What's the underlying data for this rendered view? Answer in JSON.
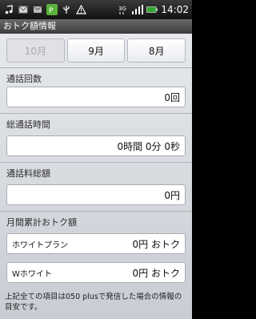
{
  "status_bar": {
    "icons_left": [
      "music-icon",
      "message-icon",
      "mail-icon",
      "app-icon",
      "usb-icon",
      "warning-icon"
    ],
    "network": "3G",
    "time": "14:02"
  },
  "title": "おトク額情報",
  "tabs": [
    {
      "label": "10月",
      "state": "disabled"
    },
    {
      "label": "9月",
      "state": "normal"
    },
    {
      "label": "8月",
      "state": "normal"
    }
  ],
  "call_count": {
    "label": "通話回数",
    "value": "0回"
  },
  "call_time": {
    "label": "総通話時間",
    "value": "0時間 0分 0秒"
  },
  "call_fee": {
    "label": "通話料総額",
    "value": "0円"
  },
  "monthly_savings": {
    "label": "月間累計おトク額",
    "plans": [
      {
        "name": "ホワイトプラン",
        "value": "0円 おトク"
      },
      {
        "name": "Wホワイト",
        "value": "0円 おトク"
      }
    ]
  },
  "footnote": "上記全ての項目は050 plusで発信した場合の情報の目安です。"
}
